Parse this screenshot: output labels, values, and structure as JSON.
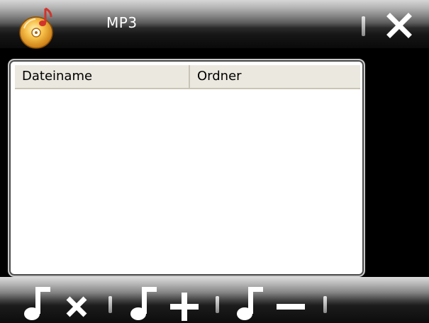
{
  "window": {
    "title": "MP3",
    "app_icon": "music-disc-icon",
    "close_icon": "close-icon"
  },
  "list": {
    "columns": [
      "Dateiname",
      "Ordner"
    ],
    "rows": []
  },
  "toolbar": {
    "buttons": [
      {
        "name": "clear-playlist-button",
        "icon": "note-x-icon"
      },
      {
        "name": "add-track-button",
        "icon": "note-plus-icon"
      },
      {
        "name": "remove-track-button",
        "icon": "note-minus-icon"
      }
    ]
  },
  "colors": {
    "background": "#000000",
    "list_header": "#ebe8df",
    "list_body": "#ffffff",
    "disc": "#f5b83c",
    "note": "#e0504a"
  }
}
